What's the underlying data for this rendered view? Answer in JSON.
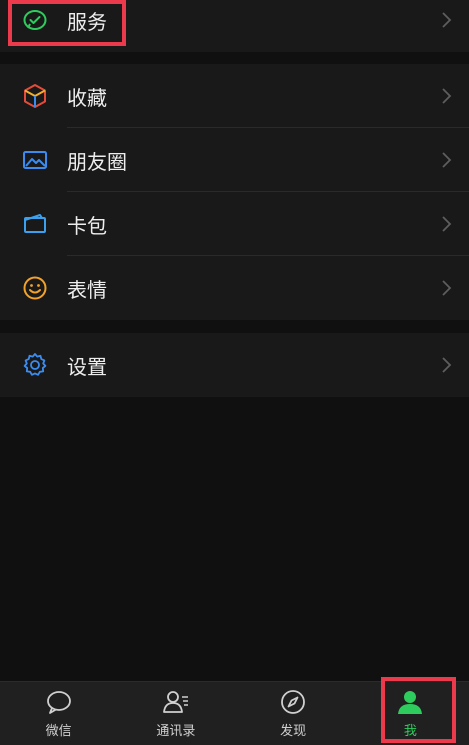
{
  "menu": {
    "service": {
      "label": "服务",
      "icon": "wechat-pay-icon"
    },
    "group2": [
      {
        "label": "收藏",
        "icon": "favorites-cube-icon"
      },
      {
        "label": "朋友圈",
        "icon": "moments-image-icon"
      },
      {
        "label": "卡包",
        "icon": "card-wallet-icon"
      },
      {
        "label": "表情",
        "icon": "smiley-face-icon"
      }
    ],
    "settings": {
      "label": "设置",
      "icon": "gear-icon"
    }
  },
  "tabbar": {
    "tabs": [
      {
        "label": "微信",
        "icon": "chat-bubble-icon",
        "active": false
      },
      {
        "label": "通讯录",
        "icon": "contacts-icon",
        "active": false
      },
      {
        "label": "发现",
        "icon": "compass-icon",
        "active": false
      },
      {
        "label": "我",
        "icon": "person-icon",
        "active": true
      }
    ]
  },
  "colors": {
    "accent": "#2ecc5d",
    "highlight": "#ea3a4c",
    "background": "#101010",
    "cell": "#191919"
  }
}
